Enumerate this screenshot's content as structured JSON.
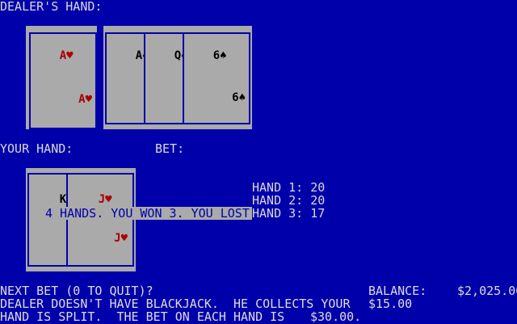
{
  "labels": {
    "dealers_hand": "DEALER'S HAND:",
    "your_hand": "YOUR HAND:",
    "bet": "BET:"
  },
  "dealer_cards": [
    {
      "rank": "A",
      "suit": "♥",
      "color": "red"
    },
    {
      "rank": "A",
      "suit": "♠",
      "color": "black"
    },
    {
      "rank": "Q",
      "suit": "♠",
      "color": "black"
    },
    {
      "rank": "6",
      "suit": "♠",
      "color": "black"
    }
  ],
  "player_cards": [
    {
      "rank": "K",
      "suit": "♠",
      "color": "black"
    },
    {
      "rank": "J",
      "suit": "♥",
      "color": "red"
    }
  ],
  "hands": [
    {
      "label": "HAND 1: 20"
    },
    {
      "label": "HAND 2: 20"
    },
    {
      "label": "HAND 3: 17"
    }
  ],
  "result_banner": "4 HANDS. YOU WON 3. YOU LOST 1.",
  "status": {
    "line1": "NEXT BET (0 TO QUIT)?",
    "line2": "DEALER DOESN'T HAVE BLACKJACK.  HE COLLECTS YOUR",
    "line3": "HAND IS SPLIT.  THE BET ON EACH HAND IS",
    "bet_each": "$30.00.",
    "balance_label": "BALANCE:",
    "balance_value": "$2,025.00",
    "collect_amount": "$15.00"
  },
  "colors": {
    "background": "#0000aa",
    "card": "#aaaaaa",
    "red_suit": "#aa0000",
    "black_suit": "#000000"
  }
}
